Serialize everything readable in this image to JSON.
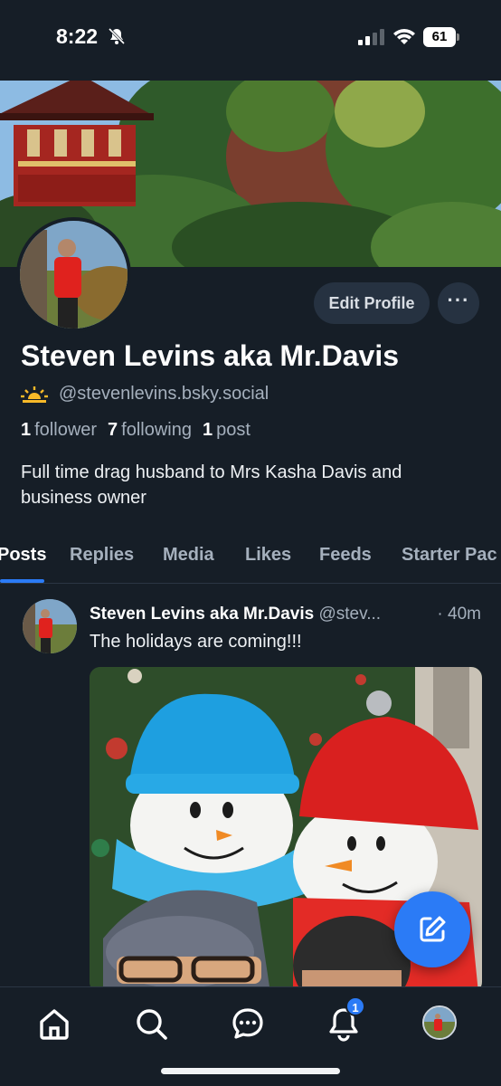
{
  "status_bar": {
    "time": "8:22",
    "battery": "61"
  },
  "profile": {
    "display_name": "Steven Levins aka Mr.Davis",
    "handle": "@stevenlevins.bsky.social",
    "followers_count": "1",
    "followers_label": "follower",
    "following_count": "7",
    "following_label": "following",
    "posts_count": "1",
    "posts_label": "post",
    "bio": "Full time drag husband to Mrs Kasha Davis and business owner",
    "edit_label": "Edit Profile",
    "more_label": "···"
  },
  "tabs": [
    {
      "label": "Posts",
      "active": true
    },
    {
      "label": "Replies"
    },
    {
      "label": "Media"
    },
    {
      "label": "Likes"
    },
    {
      "label": "Feeds"
    },
    {
      "label": "Starter Pac"
    }
  ],
  "post": {
    "author": "Steven Levins aka Mr.Davis",
    "handle": "@stev...",
    "time": "· 40m",
    "text": "The holidays are coming!!!"
  },
  "nav": {
    "items": [
      "home-icon",
      "search-icon",
      "chat-icon",
      "bell-icon",
      "avatar"
    ],
    "notification_badge": "1"
  },
  "colors": {
    "background": "#161e27",
    "accent": "#2b7bf6",
    "muted": "#a5b0bd"
  }
}
